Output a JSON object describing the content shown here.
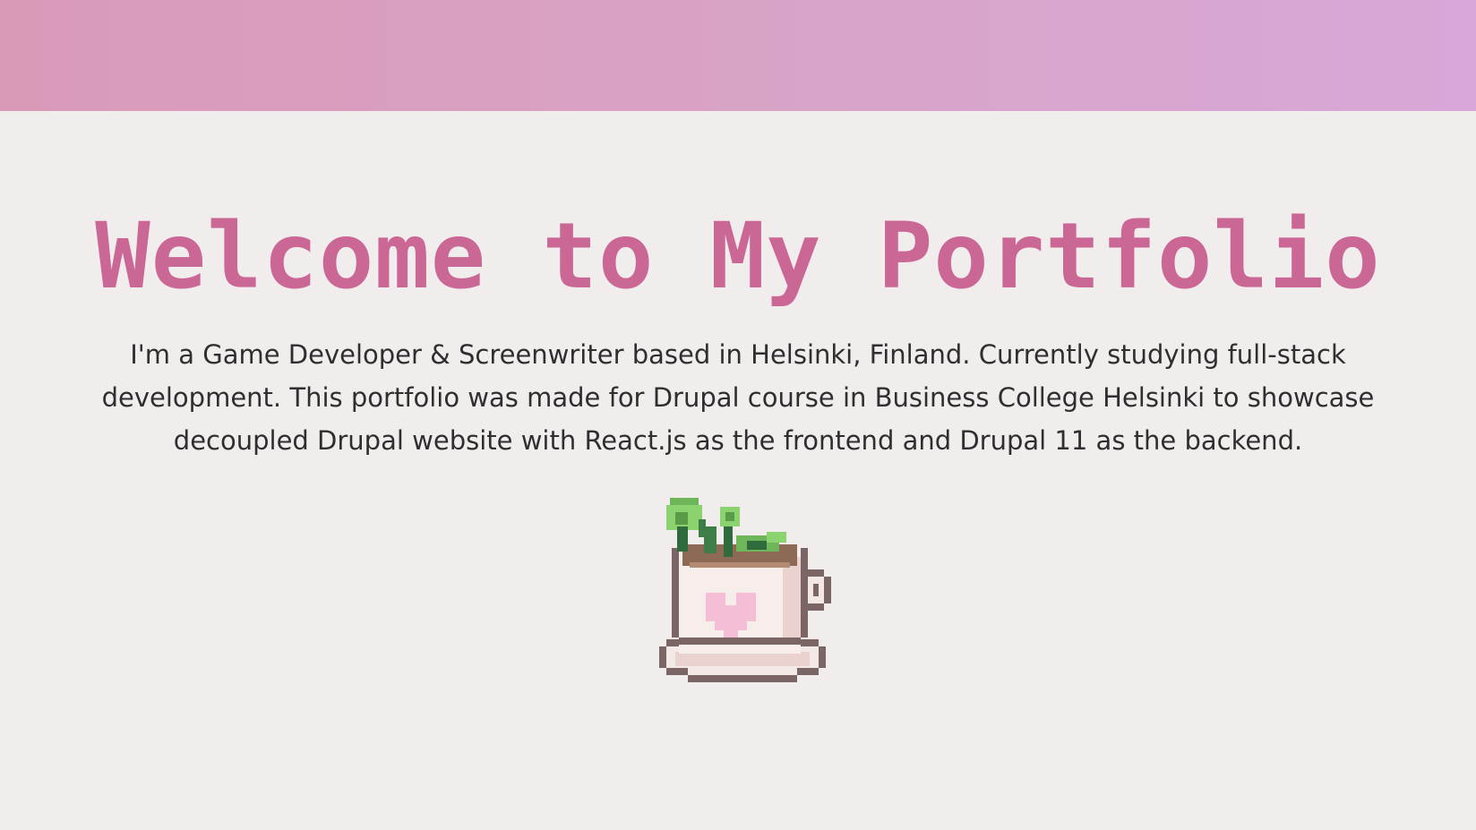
{
  "hero": {
    "title": "Welcome to My Portfolio",
    "intro": "I'm a Game Developer & Screenwriter based in Helsinki, Finland. Currently studying full-stack development. This portfolio was made for Drupal course in Business College Helsinki to showcase decoupled Drupal website with React.js as the frontend and Drupal 11 as the backend."
  },
  "colors": {
    "header_gradient_start": "#d99ab8",
    "header_gradient_end": "#d7a8d8",
    "background": "#f1eded",
    "title": "#cb6795",
    "body_text": "#2f2f2f"
  },
  "mascot": {
    "icon": "pixel-teacup-plant-icon"
  }
}
